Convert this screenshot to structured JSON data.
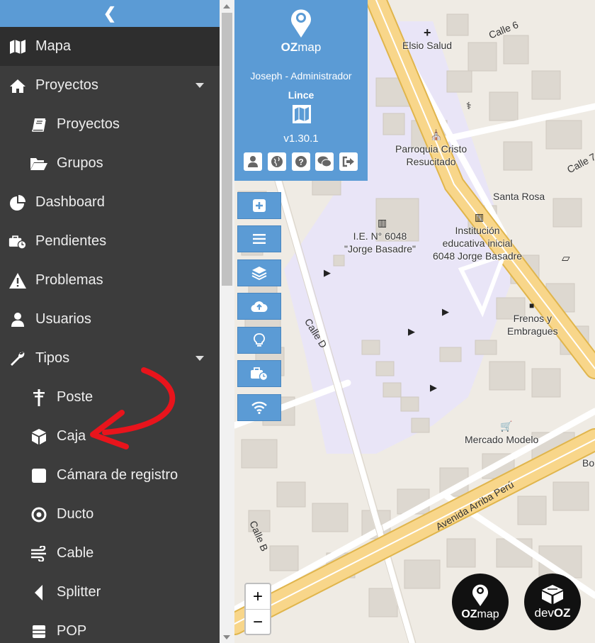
{
  "sidebar": {
    "collapse_icon": "chevron-left-icon",
    "items": [
      {
        "label": "Mapa",
        "icon": "map-icon"
      },
      {
        "label": "Proyectos",
        "icon": "home-icon"
      },
      {
        "label": "Proyectos",
        "icon": "book-icon"
      },
      {
        "label": "Grupos",
        "icon": "folder-open-icon"
      },
      {
        "label": "Dashboard",
        "icon": "pie-chart-icon"
      },
      {
        "label": "Pendientes",
        "icon": "briefcase-clock-icon"
      },
      {
        "label": "Problemas",
        "icon": "warning-icon"
      },
      {
        "label": "Usuarios",
        "icon": "user-icon"
      },
      {
        "label": "Tipos",
        "icon": "wrench-icon"
      },
      {
        "label": "Poste",
        "icon": "pole-icon"
      },
      {
        "label": "Caja",
        "icon": "cube-icon"
      },
      {
        "label": "Cámara de registro",
        "icon": "square-icon"
      },
      {
        "label": "Ducto",
        "icon": "bullseye-icon"
      },
      {
        "label": "Cable",
        "icon": "cable-icon"
      },
      {
        "label": "Splitter",
        "icon": "caret-left-icon"
      },
      {
        "label": "POP",
        "icon": "server-icon"
      }
    ]
  },
  "info_panel": {
    "logo_oz": "OZ",
    "logo_map": "map",
    "user": "Joseph - Administrador",
    "project": "Lince",
    "version": "v1.30.1"
  },
  "map_labels": {
    "elsio": "Elsio Salud",
    "calle6": "Calle 6",
    "parroquia": "Parroquia Cristo\nResucitado",
    "santa_rosa": "Santa Rosa",
    "calle7": "Calle 7",
    "ie": "I.E. N° 6048\n\"Jorge Basadre\"",
    "institucion": "Institución\neducativa inicial\n6048 Jorge Basadre",
    "frenos": "Frenos y\nEmbragues",
    "calle_d": "Calle D",
    "mercado": "Mercado Modelo",
    "bo": "Bo",
    "avenida": "Avenida Arriba Perú",
    "calle_b": "Calle B"
  },
  "zoom": {
    "in": "+",
    "out": "−"
  },
  "logos": {
    "ozmap_oz": "OZ",
    "ozmap_map": "map",
    "devoz_dev": "dev",
    "devoz_oz": "OZ"
  },
  "colors": {
    "accent": "#5b9bd5",
    "sidebar": "#3c3c3c",
    "arrow": "#e8141c",
    "campus": "#e8e4f5",
    "major_road": "#f8d68a"
  }
}
